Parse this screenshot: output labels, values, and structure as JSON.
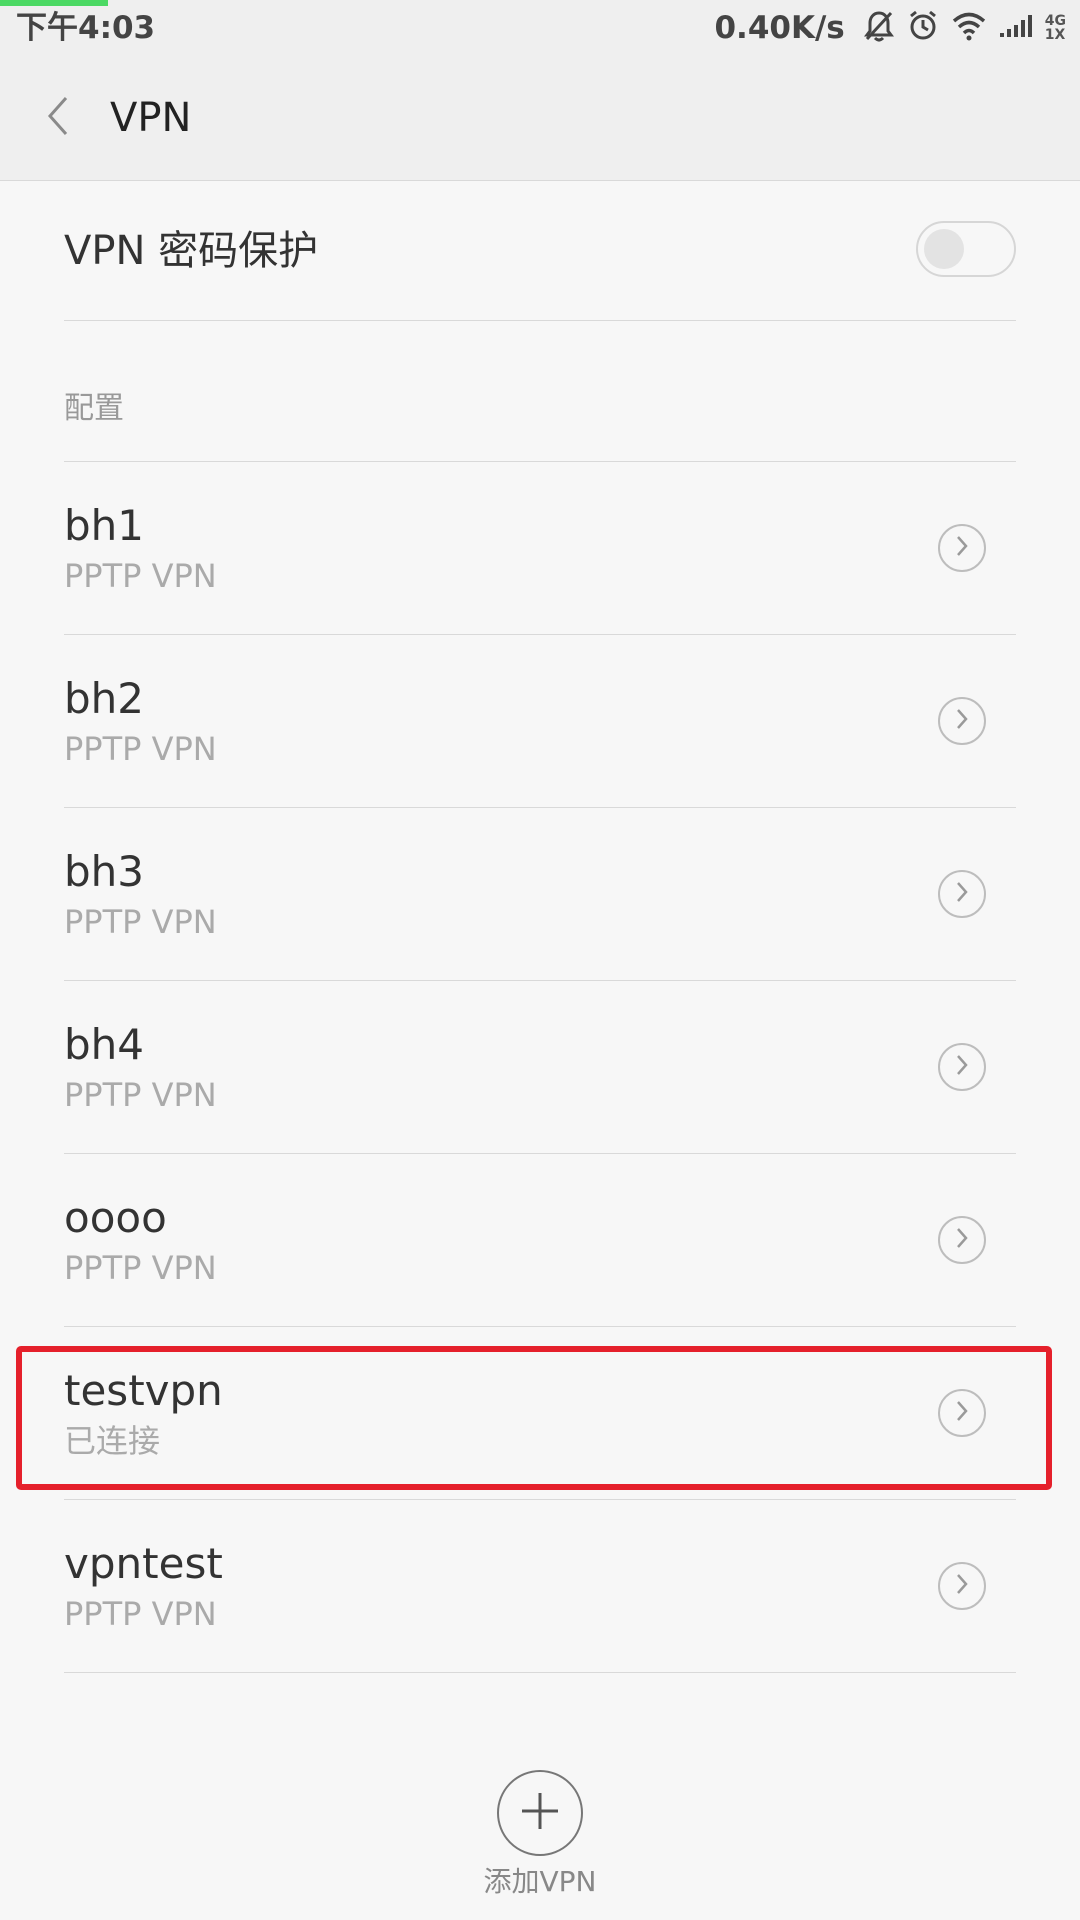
{
  "status_bar": {
    "time": "下午4:03",
    "network_speed": "0.40K/s",
    "network_type_top": "4G",
    "network_type_bottom": "1X",
    "icons": [
      "bell-off-icon",
      "alarm-icon",
      "wifi-icon",
      "signal-icon"
    ],
    "progress_color": "#4cd964"
  },
  "header": {
    "title": "VPN",
    "back_icon": "chevron-left-icon"
  },
  "password_protection": {
    "label": "VPN 密码保护",
    "enabled": false
  },
  "section": {
    "label": "配置"
  },
  "vpn_list": [
    {
      "name": "bh1",
      "subtitle": "PPTP VPN"
    },
    {
      "name": "bh2",
      "subtitle": "PPTP VPN"
    },
    {
      "name": "bh3",
      "subtitle": "PPTP VPN"
    },
    {
      "name": "bh4",
      "subtitle": "PPTP VPN"
    },
    {
      "name": "oooo",
      "subtitle": "PPTP VPN"
    },
    {
      "name": "testvpn",
      "subtitle": "已连接",
      "highlighted": true
    },
    {
      "name": "vpntest",
      "subtitle": "PPTP VPN"
    }
  ],
  "highlight_color": "#e5202b",
  "add_button": {
    "label": "添加VPN",
    "icon": "plus-icon"
  }
}
